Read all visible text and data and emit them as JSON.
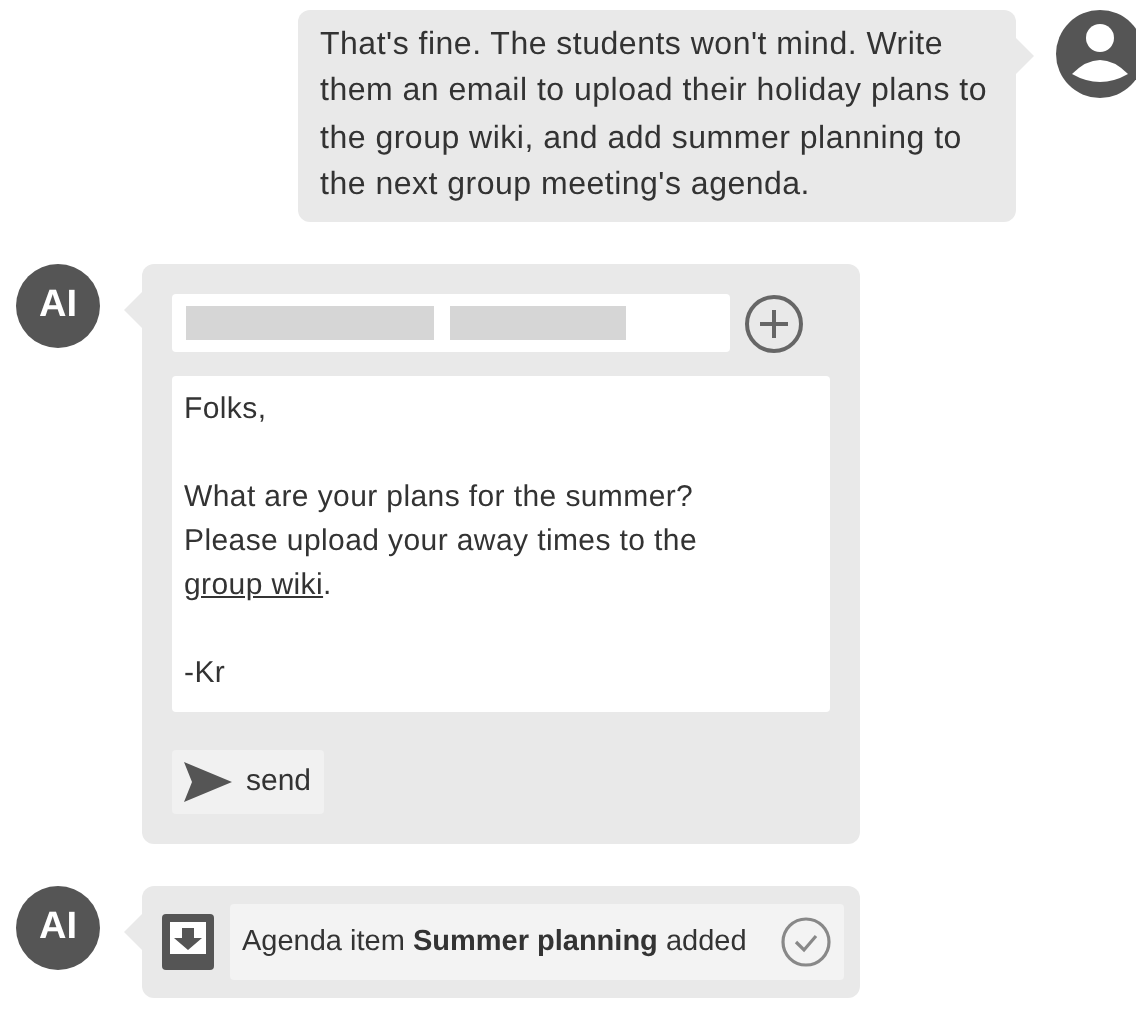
{
  "messages": [
    {
      "kind": "user",
      "text": "That's fine. The students won't mind. Write them an email to upload their holiday plans to the group wiki, and add summer planning to the next group meeting's agenda."
    },
    {
      "kind": "email",
      "avatar": "AI",
      "paragraphs": [
        {
          "text": "Folks,"
        },
        {
          "text": "What are your plans for the summer?\nPlease upload your away times to the ",
          "link": "group wiki",
          "after": "."
        },
        {
          "text": "-Kr"
        }
      ],
      "send_label": "send"
    },
    {
      "kind": "notice",
      "avatar": "AI",
      "text": "Agenda item **Summer planning** added"
    }
  ]
}
